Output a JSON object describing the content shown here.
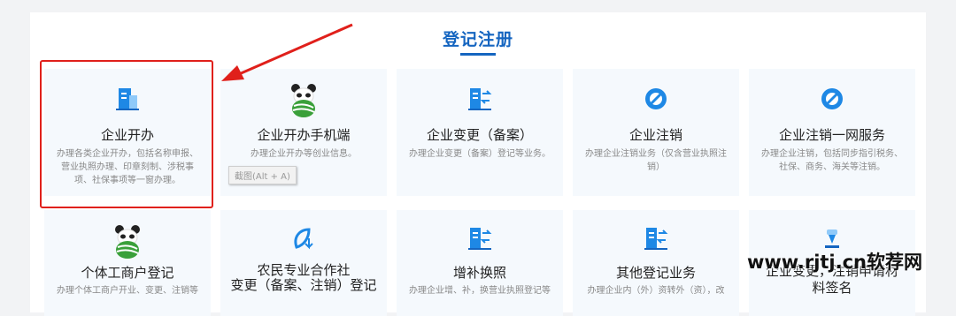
{
  "section_title": "登记注册",
  "tooltip": "截图(Alt + A)",
  "watermark": "www.rjtj.cn软荐网",
  "colors": {
    "accent": "#1565c0",
    "highlight": "#e0201b",
    "icon_blue": "#1e88e5",
    "icon_light": "#90caf9"
  },
  "services_row1": [
    {
      "name": "企业开办",
      "desc": "办理各类企业开办，包括名称申报、营业执照办理、印章刻制、涉税事项、社保事项等一窗办理。",
      "icon": "building-icon"
    },
    {
      "name": "企业开办手机端",
      "desc": "办理企业开办等创业信息。",
      "icon": "panda-app-icon"
    },
    {
      "name": "企业变更（备案）",
      "desc": "办理企业变更（备案）登记等业务。",
      "icon": "building-exchange-icon"
    },
    {
      "name": "企业注销",
      "desc": "办理企业注销业务（仅含营业执照注销）",
      "icon": "cancel-circle-icon"
    },
    {
      "name": "企业注销一网服务",
      "desc": "办理企业注销，包括同步指引税务、社保、商务、海关等注销。",
      "icon": "cancel-circle-icon"
    }
  ],
  "services_row2": [
    {
      "name": "个体工商户登记",
      "desc": "办理个体工商户开业、变更、注销等",
      "icon": "panda-app-icon"
    },
    {
      "name": "农民专业合作社\n变更（备案、注销）登记",
      "desc": "",
      "icon": "leaf-arrow-icon"
    },
    {
      "name": "增补换照",
      "desc": "办理企业增、补，换营业执照登记等",
      "icon": "building-exchange-icon"
    },
    {
      "name": "其他登记业务",
      "desc": "办理企业内（外）资转外（资），改",
      "icon": "building-exchange-icon"
    },
    {
      "name": "企业变更，注销申请材料签名",
      "desc": "",
      "icon": "signature-icon"
    }
  ]
}
